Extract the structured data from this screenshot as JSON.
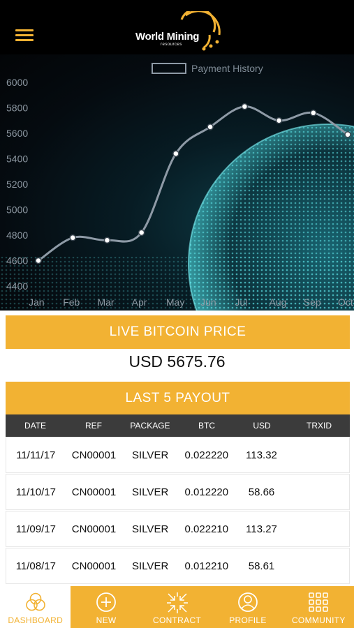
{
  "header": {
    "logo_text": "World Mining",
    "logo_sub": "resources"
  },
  "chart_data": {
    "type": "line",
    "legend": "Payment History",
    "legend_position": "top-center",
    "categories": [
      "Jan",
      "Feb",
      "Mar",
      "Apr",
      "May",
      "Jun",
      "Jul",
      "Aug",
      "Sep",
      "Oct"
    ],
    "series": [
      {
        "name": "Payment History",
        "values": [
          4600,
          4780,
          4760,
          4820,
          5440,
          5650,
          5810,
          5700,
          5760,
          5590
        ]
      }
    ],
    "y_ticks": [
      "6000",
      "5800",
      "5600",
      "5400",
      "5200",
      "5000",
      "4800",
      "4600",
      "4400"
    ],
    "ylim": [
      4400,
      6000
    ],
    "line_color": "#8e9aa6"
  },
  "live_price": {
    "title": "LIVE BITCOIN PRICE",
    "value": "USD 5675.76"
  },
  "payouts": {
    "title": "LAST 5 PAYOUT",
    "columns": [
      "DATE",
      "REF",
      "PACKAGE",
      "BTC",
      "USD",
      "TRXID"
    ],
    "rows": [
      [
        "11/11/17",
        "CN00001",
        "SILVER",
        "0.022220",
        "113.32",
        ""
      ],
      [
        "11/10/17",
        "CN00001",
        "SILVER",
        "0.012220",
        "58.66",
        ""
      ],
      [
        "11/09/17",
        "CN00001",
        "SILVER",
        "0.022210",
        "113.27",
        ""
      ],
      [
        "11/08/17",
        "CN00001",
        "SILVER",
        "0.012210",
        "58.61",
        ""
      ]
    ]
  },
  "tabs": [
    {
      "label": "DASHBOARD",
      "icon": "dashboard-circles-icon",
      "active": true
    },
    {
      "label": "NEW",
      "icon": "plus-circle-icon",
      "active": false
    },
    {
      "label": "CONTRACT",
      "icon": "contract-arrows-icon",
      "active": false
    },
    {
      "label": "PROFILE",
      "icon": "profile-icon",
      "active": false
    },
    {
      "label": "COMMUNITY",
      "icon": "grid-icon",
      "active": false
    }
  ],
  "colors": {
    "accent": "#f2b233",
    "header_bg": "#000000",
    "table_header_bg": "#3b3b3b"
  }
}
